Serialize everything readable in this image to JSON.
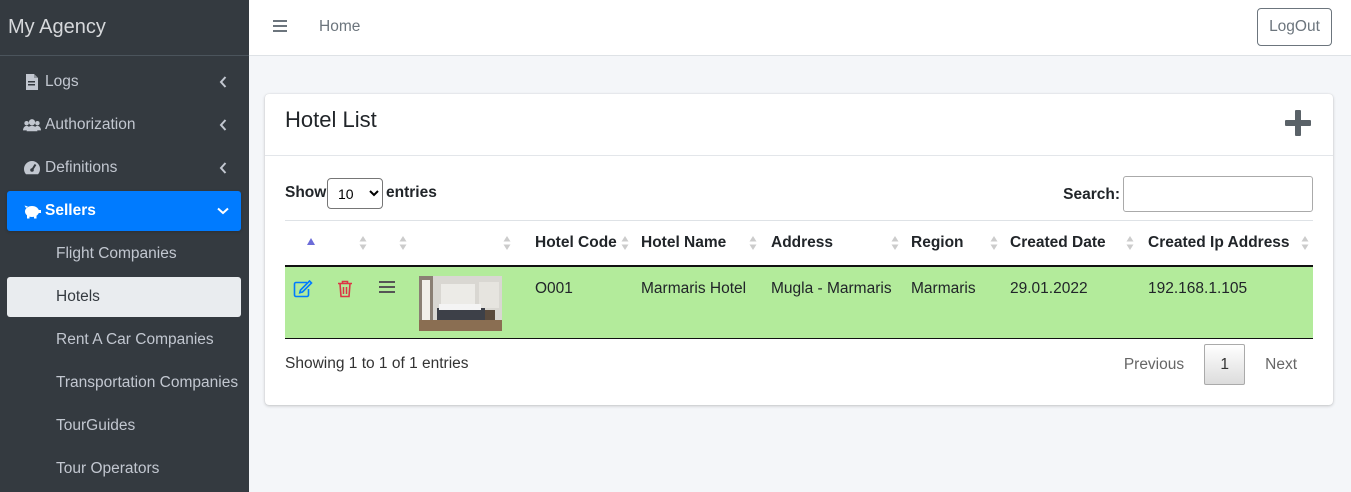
{
  "brand": "My Agency",
  "sidebar": {
    "items": [
      {
        "label": "Logs",
        "icon": "file-icon"
      },
      {
        "label": "Authorization",
        "icon": "users-icon"
      },
      {
        "label": "Definitions",
        "icon": "gauge-icon"
      },
      {
        "label": "Sellers",
        "icon": "piggy-bank-icon"
      }
    ],
    "sub_items": [
      {
        "label": "Flight Companies"
      },
      {
        "label": "Hotels"
      },
      {
        "label": "Rent A Car Companies"
      },
      {
        "label": "Transportation Companies"
      },
      {
        "label": "TourGuides"
      },
      {
        "label": "Tour Operators"
      }
    ]
  },
  "topbar": {
    "home": "Home",
    "logout": "LogOut"
  },
  "card": {
    "title": "Hotel List",
    "show_label": "Show",
    "entries_value": "10",
    "entries_label": "entries",
    "search_label": "Search:",
    "columns": [
      "",
      "",
      "",
      "",
      "Hotel Code",
      "Hotel Name",
      "Address",
      "Region",
      "Created Date",
      "Created Ip Address"
    ],
    "rows": [
      {
        "code": "O001",
        "name": "Marmaris Hotel",
        "address": "Mugla - Marmaris",
        "region": "Marmaris",
        "created_date": "29.01.2022",
        "ip": "192.168.1.105"
      }
    ],
    "info": "Showing 1 to 1 of 1 entries",
    "prev": "Previous",
    "page": "1",
    "next": "Next"
  },
  "colors": {
    "accent": "#007bff",
    "row_highlight": "#b3eb9b",
    "sidebar": "#343a40",
    "edit": "#007bff",
    "delete": "#dc3545"
  }
}
